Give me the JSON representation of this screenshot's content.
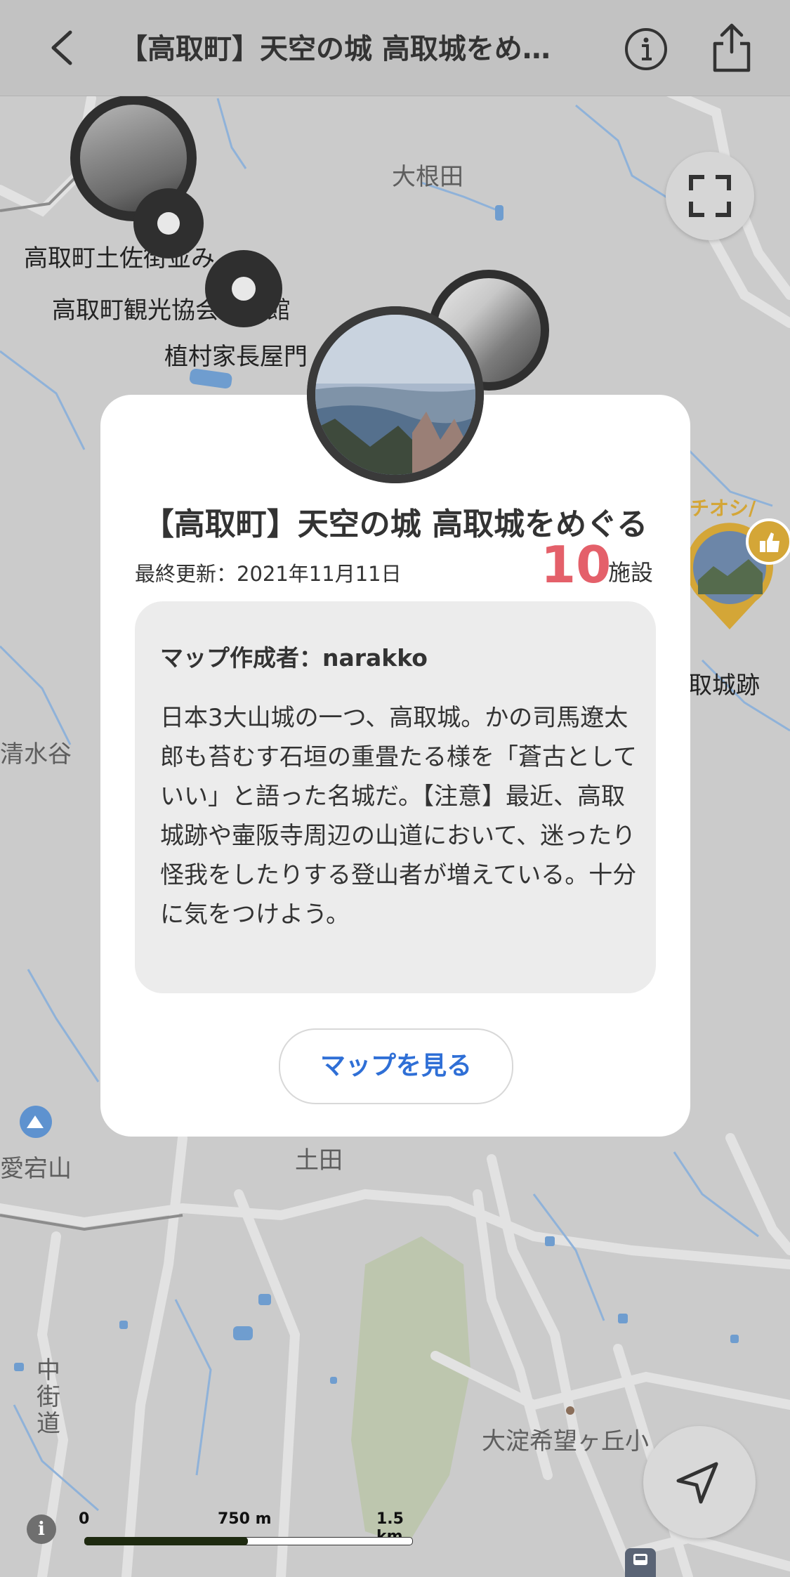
{
  "topbar": {
    "title": "【高取町】天空の城 高取城をめ…"
  },
  "map": {
    "labels": {
      "oneda": "大根田",
      "tosa": "高取町土佐街並み",
      "kanko": "高取町観光協会夢創館",
      "uemura": "植村家長屋門",
      "shimizudani": "清水谷",
      "atagoyama": "愛宕山",
      "tsuchida": "土田",
      "nakakaido": "中街道",
      "ooyodo": "大淀希望ヶ丘小",
      "castle_ruins": "取城跡",
      "osusume": "チオシ/"
    },
    "scale": {
      "zero": "0",
      "mid": "750 m",
      "max": "1.5 km"
    }
  },
  "card": {
    "title": "【高取町】天空の城 高取城をめぐる",
    "updated": "最終更新：2021年11月11日",
    "count": "10",
    "count_unit": "施設",
    "author": "マップ作成者：narakko",
    "description": "日本3大山城の一つ、高取城。かの司馬遼太郎も苔むす石垣の重畳たる様を「蒼古としていい」と語った名城だ。【注意】最近、高取城跡や壷阪寺周辺の山道において、迷ったり怪我をしたりする登山者が増えている。十分に気をつけよう。",
    "button": "マップを見る"
  },
  "colors": {
    "accent_red": "#e4606a",
    "link_blue": "#2f6fd6",
    "map_bg": "#cbcbcb",
    "road": "#e0e0e0",
    "water": "#7da7d3",
    "gold": "#d4a637"
  },
  "icons": {
    "back": "chevron-left-icon",
    "info": "info-icon",
    "share": "share-icon",
    "fullscreen": "fullscreen-icon",
    "locate": "location-arrow-icon",
    "thumb": "thumbs-up-icon",
    "mountain": "mountain-icon",
    "train": "train-icon"
  }
}
